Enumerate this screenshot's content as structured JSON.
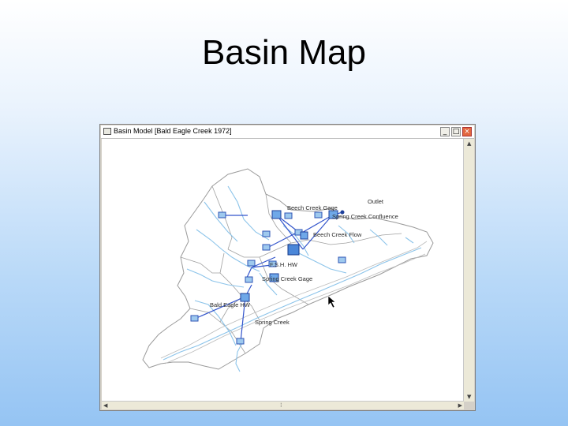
{
  "slide": {
    "title": "Basin Map"
  },
  "window": {
    "title": "Basin Model [Bald Eagle Creek 1972]",
    "controls": {
      "minimize": "_",
      "maximize": "□",
      "close": "×"
    }
  },
  "map": {
    "labels": {
      "outlet": "Outlet",
      "beech_creek_gage": "Beech Creek Gage",
      "spring_creek_confluence": "Spring Creek Confluence",
      "beech_creek_flow": "Beech Creek Flow",
      "fsh_hw": "F.S.H. HW",
      "spring_creek_gage": "Spring Creek Gage",
      "bald_eagle_hw": "Bald Eagle HW",
      "spring_creek": "Spring Creek"
    }
  }
}
